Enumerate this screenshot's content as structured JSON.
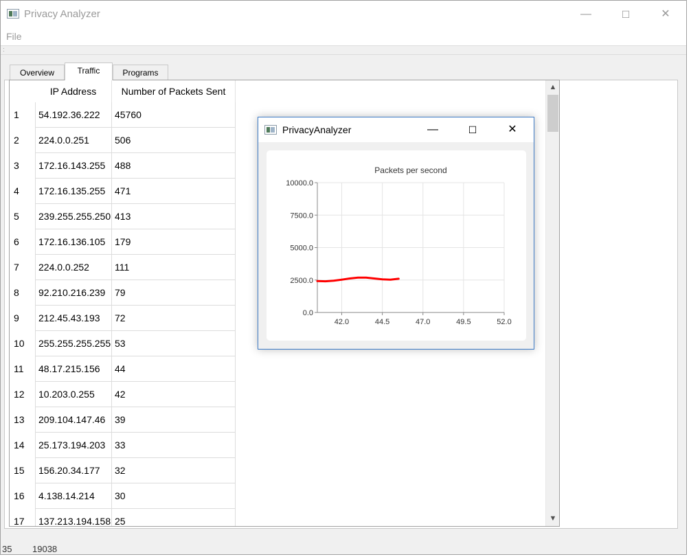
{
  "window": {
    "title": "Privacy Analyzer",
    "minimize_glyph": "—",
    "maximize_glyph": "☐",
    "close_glyph": "✕"
  },
  "menu": {
    "file": "File"
  },
  "tabs": [
    {
      "label": "Overview"
    },
    {
      "label": "Traffic",
      "active": true
    },
    {
      "label": "Programs"
    }
  ],
  "table": {
    "headers": {
      "ip": "IP Address",
      "packets": "Number of Packets Sent"
    },
    "rows": [
      {
        "num": "1",
        "ip": "54.192.36.222",
        "packets": "45760"
      },
      {
        "num": "2",
        "ip": "224.0.0.251",
        "packets": "506"
      },
      {
        "num": "3",
        "ip": "172.16.143.255",
        "packets": "488"
      },
      {
        "num": "4",
        "ip": "172.16.135.255",
        "packets": "471"
      },
      {
        "num": "5",
        "ip": "239.255.255.250",
        "packets": "413"
      },
      {
        "num": "6",
        "ip": "172.16.136.105",
        "packets": "179"
      },
      {
        "num": "7",
        "ip": "224.0.0.252",
        "packets": "111"
      },
      {
        "num": "8",
        "ip": "92.210.216.239",
        "packets": "79"
      },
      {
        "num": "9",
        "ip": "212.45.43.193",
        "packets": "72"
      },
      {
        "num": "10",
        "ip": "255.255.255.255",
        "packets": "53"
      },
      {
        "num": "11",
        "ip": "48.17.215.156",
        "packets": "44"
      },
      {
        "num": "12",
        "ip": "10.203.0.255",
        "packets": "42"
      },
      {
        "num": "13",
        "ip": "209.104.147.46",
        "packets": "39"
      },
      {
        "num": "14",
        "ip": "25.173.194.203",
        "packets": "33"
      },
      {
        "num": "15",
        "ip": "156.20.34.177",
        "packets": "32"
      },
      {
        "num": "16",
        "ip": "4.138.14.214",
        "packets": "30"
      },
      {
        "num": "17",
        "ip": "137.213.194.158",
        "packets": "25"
      }
    ]
  },
  "scrollbar": {
    "up": "▲",
    "down": "▼"
  },
  "dialog": {
    "title": "PrivacyAnalyzer",
    "minimize_glyph": "—",
    "maximize_glyph": "☐",
    "close_glyph": "✕"
  },
  "chart_data": {
    "type": "line",
    "title": "Packets per second",
    "xlabel": "",
    "ylabel": "",
    "xlim": [
      40.5,
      52.0
    ],
    "ylim": [
      0,
      10000
    ],
    "x_ticks": [
      "42.0",
      "44.5",
      "47.0",
      "49.5",
      "52.0"
    ],
    "x_tick_values": [
      42.0,
      44.5,
      47.0,
      49.5,
      52.0
    ],
    "y_ticks": [
      "0.0",
      "2500.0",
      "5000.0",
      "7500.0",
      "10000.0"
    ],
    "y_tick_values": [
      0,
      2500,
      5000,
      7500,
      10000
    ],
    "grid": true,
    "series": [
      {
        "color": "#ff0000",
        "x": [
          40.5,
          41.0,
          41.5,
          42.0,
          42.5,
          43.0,
          43.5,
          44.0,
          44.5,
          45.0,
          45.5
        ],
        "y": [
          2420,
          2400,
          2450,
          2530,
          2620,
          2680,
          2680,
          2620,
          2550,
          2530,
          2600
        ]
      }
    ]
  },
  "peek_text": {
    "left": "35",
    "right": "19038"
  }
}
